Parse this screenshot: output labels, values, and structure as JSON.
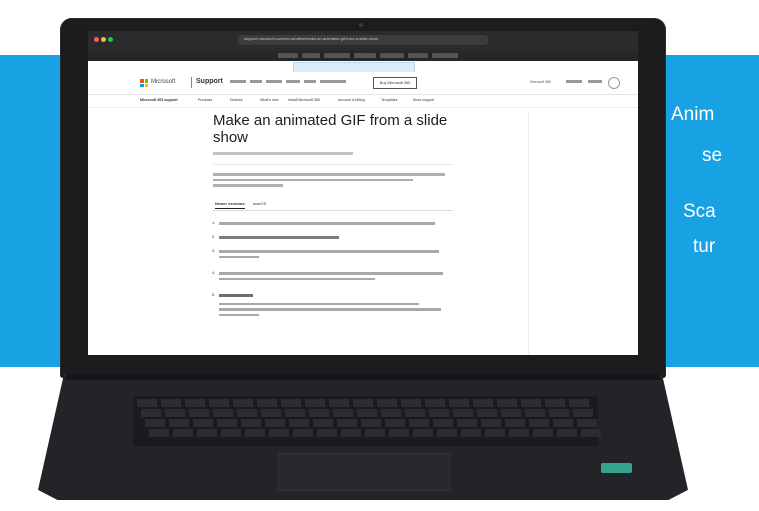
{
  "promo": {
    "line1": "Anim",
    "line2": "se",
    "line3": "Sca",
    "line4": "tur"
  },
  "browser": {
    "address": "support.microsoft.com/en-us/office/make-an-animated-gif-from-a-slide-show"
  },
  "site": {
    "brand": "Microsoft",
    "section": "Support",
    "buy_button": "Buy Microsoft 365",
    "signin": "Microsoft 365",
    "sub_nav": [
      "Microsoft 365 support",
      "Products",
      "Devices",
      "What's new",
      "Install Microsoft 365",
      "Account & billing",
      "Templates",
      "More support"
    ]
  },
  "article": {
    "title": "Make an animated GIF from a slide show",
    "tabs": [
      "Newer versions",
      "macOS"
    ]
  },
  "colors": {
    "band": "#19a2e3",
    "laptop": "#1b1c1e",
    "accent_led": "#36a58f"
  }
}
